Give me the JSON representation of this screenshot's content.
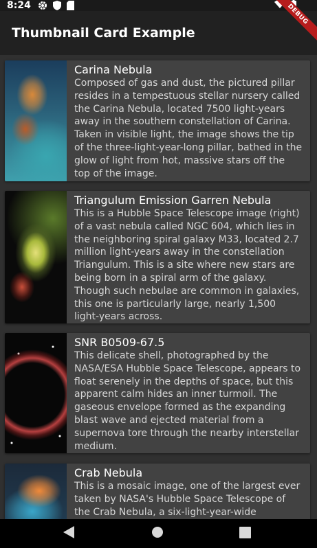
{
  "status_bar": {
    "time": "8:24"
  },
  "app_bar": {
    "title": "Thumbnail Card Example",
    "debug_label": "DEBUG"
  },
  "cards": [
    {
      "title": "Carina Nebula",
      "description": "Composed of gas and dust, the pictured pillar resides in a tempestuous stellar nursery called the Carina Nebula, located 7500 light-years away in the southern constellation of Carina. Taken in visible light, the image shows the tip of the three-light-year-long pillar, bathed in the glow of light from hot, massive stars off the top of the image."
    },
    {
      "title": "Triangulum Emission Garren Nebula",
      "description": "This is a Hubble Space Telescope image (right) of a vast nebula called NGC 604, which lies in the neighboring spiral galaxy M33, located 2.7 million light-years away in the constellation Triangulum. This is a site where new stars are being born in a spiral arm of the galaxy. Though such nebulae are common in galaxies, this one is particularly large, nearly 1,500 light-years across."
    },
    {
      "title": "SNR B0509-67.5",
      "description": "This delicate shell, photographed by the NASA/ESA Hubble Space Telescope, appears to float serenely in the depths of space, but this apparent calm hides an inner turmoil. The gaseous envelope formed as the expanding blast wave and ejected material from a supernova tore through the nearby interstellar medium."
    },
    {
      "title": "Crab Nebula",
      "description": "This is a mosaic image, one of the largest ever taken by NASA's Hubble Space Telescope of the Crab Nebula, a six-light-year-wide"
    }
  ],
  "colors": {
    "background": "#303030",
    "app_bar": "#212121",
    "card": "#424242",
    "debug_ribbon": "#b71c1c"
  },
  "icons": {
    "status_left": [
      "settings-icon",
      "shield-icon",
      "sd-card-icon"
    ],
    "status_right": [
      "wifi-icon",
      "battery-icon"
    ],
    "navigation": [
      "back-icon",
      "home-icon",
      "recents-icon"
    ]
  }
}
